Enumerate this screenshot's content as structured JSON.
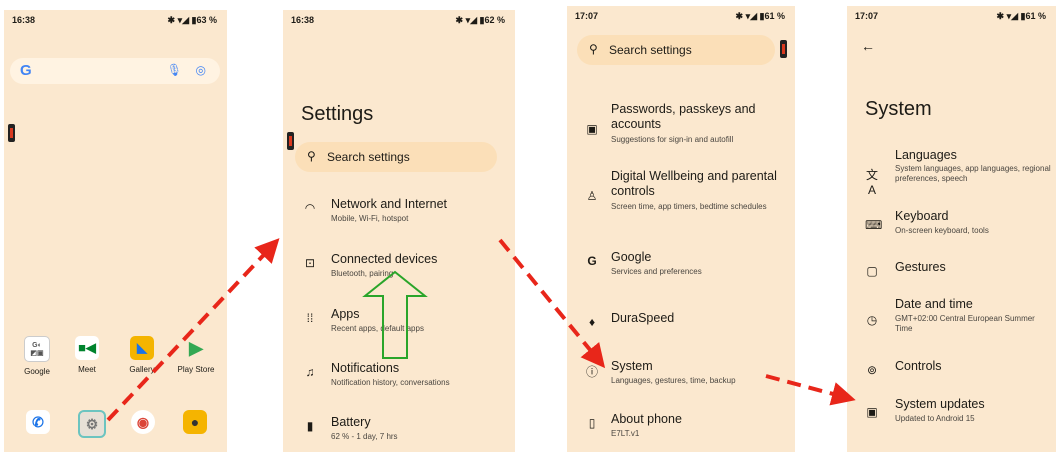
{
  "phone1": {
    "status": {
      "time": "16:38",
      "battery": "63 %"
    },
    "search": {
      "logo": "G"
    },
    "apps": [
      {
        "label": "Google",
        "icon": "google-folder-icon"
      },
      {
        "label": "Meet",
        "icon": "meet-icon"
      },
      {
        "label": "Gallery",
        "icon": "gallery-icon"
      },
      {
        "label": "Play Store",
        "icon": "play-store-icon"
      }
    ],
    "dock": [
      "phone-icon",
      "settings-icon",
      "chrome-icon",
      "camera-icon"
    ]
  },
  "phone2": {
    "status": {
      "time": "16:38",
      "battery": "62 %"
    },
    "title": "Settings",
    "search_placeholder": "Search settings",
    "items": [
      {
        "title": "Network and Internet",
        "subtitle": "Mobile, Wi-Fi, hotspot",
        "icon": "wifi-icon"
      },
      {
        "title": "Connected devices",
        "subtitle": "Bluetooth, pairing",
        "icon": "connected-devices-icon"
      },
      {
        "title": "Apps",
        "subtitle": "Recent apps, default apps",
        "icon": "apps-grid-icon"
      },
      {
        "title": "Notifications",
        "subtitle": "Notification history, conversations",
        "icon": "bell-icon"
      },
      {
        "title": "Battery",
        "subtitle": "62 % - 1 day, 7 hrs",
        "icon": "battery-icon"
      }
    ]
  },
  "phone3": {
    "status": {
      "time": "17:07",
      "battery": "61 %"
    },
    "search_placeholder": "Search settings",
    "items": [
      {
        "title": "Passwords, passkeys and accounts",
        "subtitle": "Suggestions for sign-in and autofill",
        "icon": "account-icon"
      },
      {
        "title": "Digital Wellbeing and parental controls",
        "subtitle": "Screen time, app timers, bedtime schedules",
        "icon": "wellbeing-icon"
      },
      {
        "title": "Google",
        "subtitle": "Services and preferences",
        "icon": "google-g-icon"
      },
      {
        "title": "DuraSpeed",
        "subtitle": "",
        "icon": "duraspeed-icon"
      },
      {
        "title": "System",
        "subtitle": "Languages, gestures, time, backup",
        "icon": "info-icon"
      },
      {
        "title": "About phone",
        "subtitle": "E7LT.v1",
        "icon": "phone-icon"
      }
    ]
  },
  "phone4": {
    "status": {
      "time": "17:07",
      "battery": "61 %"
    },
    "title": "System",
    "items": [
      {
        "title": "Languages",
        "subtitle": "System languages, app languages, regional preferences, speech",
        "icon": "translate-icon"
      },
      {
        "title": "Keyboard",
        "subtitle": "On-screen keyboard, tools",
        "icon": "keyboard-icon"
      },
      {
        "title": "Gestures",
        "subtitle": "",
        "icon": "gestures-icon"
      },
      {
        "title": "Date and time",
        "subtitle": "GMT+02:00 Central European Summer Time",
        "icon": "clock-icon"
      },
      {
        "title": "Controls",
        "subtitle": "",
        "icon": "controls-icon"
      },
      {
        "title": "System updates",
        "subtitle": "Updated to Android 15",
        "icon": "system-update-icon"
      }
    ]
  },
  "colors": {
    "screen_bg": "#fbe8cf",
    "arrow_red": "#e8261a",
    "arrow_green": "#2aa52a"
  }
}
